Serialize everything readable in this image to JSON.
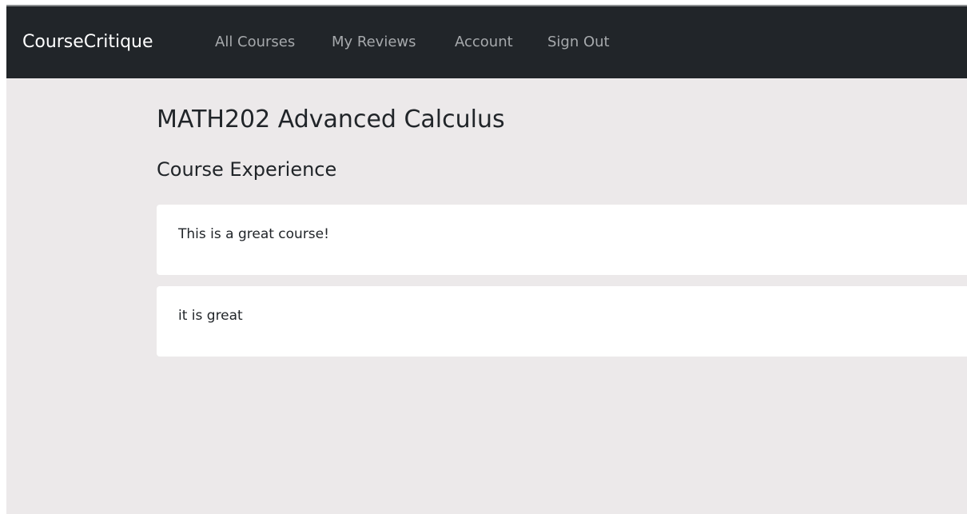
{
  "navbar": {
    "brand": "CourseCritique",
    "links": [
      "All Courses",
      "My Reviews",
      "Account",
      "Sign Out"
    ]
  },
  "main": {
    "course_title": "MATH202 Advanced Calculus",
    "section_title": "Course Experience",
    "reviews": [
      "This is a great course!",
      "it is great"
    ]
  },
  "colors": {
    "navbar_bg": "#212529",
    "page_bg": "#ece9ea",
    "card_bg": "#ffffff"
  }
}
